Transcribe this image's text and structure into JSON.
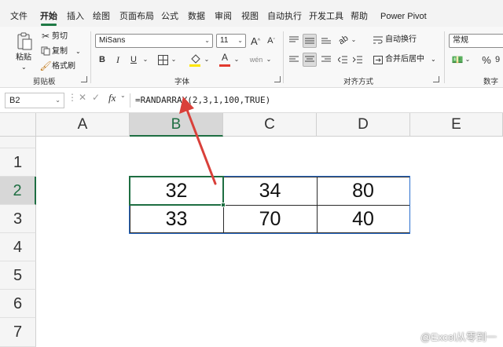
{
  "tabs": [
    "文件",
    "开始",
    "插入",
    "绘图",
    "页面布局",
    "公式",
    "数据",
    "审阅",
    "视图",
    "自动执行",
    "开发工具",
    "帮助",
    "Power Pivot"
  ],
  "active_tab": "开始",
  "ribbon": {
    "clipboard": {
      "paste": "粘贴",
      "cut": "剪切",
      "copy": "复制",
      "format_painter": "格式刷",
      "label": "剪贴板"
    },
    "font": {
      "name": "MiSans",
      "size": "11",
      "bold": "B",
      "italic": "I",
      "underline": "U",
      "grow": "A",
      "shrink": "A",
      "label": "字体"
    },
    "alignment": {
      "wrap": "自动换行",
      "merge": "合并后居中",
      "label": "对齐方式"
    },
    "number": {
      "format": "常规",
      "percent": "%",
      "label": "数字"
    }
  },
  "formula_bar": {
    "name_box": "B2",
    "fx": "fx",
    "formula": "=RANDARRAY(2,3,1,100,TRUE)"
  },
  "columns": [
    "A",
    "B",
    "C",
    "D",
    "E"
  ],
  "active_column": "B",
  "rows": [
    "1",
    "2",
    "3",
    "4",
    "5",
    "6",
    "7"
  ],
  "active_row": "2",
  "cells": {
    "B2": "32",
    "C2": "34",
    "D2": "80",
    "B3": "33",
    "C3": "70",
    "D3": "40"
  },
  "colors": {
    "accent": "#1e6e42",
    "arrow": "#d9403a",
    "selection": "#2a6fcf"
  },
  "watermark": "@Excel从零到一"
}
